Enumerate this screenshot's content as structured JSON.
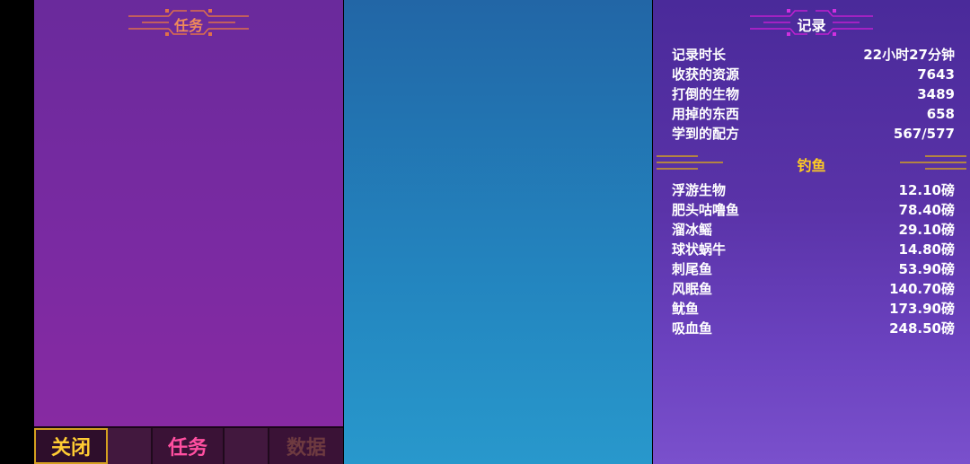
{
  "left_panel": {
    "title": "任务",
    "tabs": [
      {
        "label": "关闭"
      },
      {
        "label": "任务"
      },
      {
        "label": "数据"
      }
    ]
  },
  "right_panel": {
    "title": "记录",
    "stats": [
      {
        "label": "记录时长",
        "value": "22小时27分钟"
      },
      {
        "label": "收获的资源",
        "value": "7643"
      },
      {
        "label": "打倒的生物",
        "value": "3489"
      },
      {
        "label": "用掉的东西",
        "value": "658"
      },
      {
        "label": "学到的配方",
        "value": "567/577"
      }
    ],
    "fishing": {
      "title": "钓鱼",
      "items": [
        {
          "name": "浮游生物",
          "weight": "12.10磅"
        },
        {
          "name": "肥头咕噜鱼",
          "weight": "78.40磅"
        },
        {
          "name": "溜冰鳐",
          "weight": "29.10磅"
        },
        {
          "name": "球状蜗牛",
          "weight": "14.80磅"
        },
        {
          "name": "刺尾鱼",
          "weight": "53.90磅"
        },
        {
          "name": "风眠鱼",
          "weight": "140.70磅"
        },
        {
          "name": "鱿鱼",
          "weight": "173.90磅"
        },
        {
          "name": "吸血鱼",
          "weight": "248.50磅"
        }
      ]
    }
  },
  "colors": {
    "left_bg": "#7b2aa2",
    "middle_bg": "#2385bf",
    "right_bg": "#5a33a8",
    "accent_gold": "#ffcc22",
    "accent_pink": "#ff4fa0",
    "header_orange": "#f08a5a"
  }
}
